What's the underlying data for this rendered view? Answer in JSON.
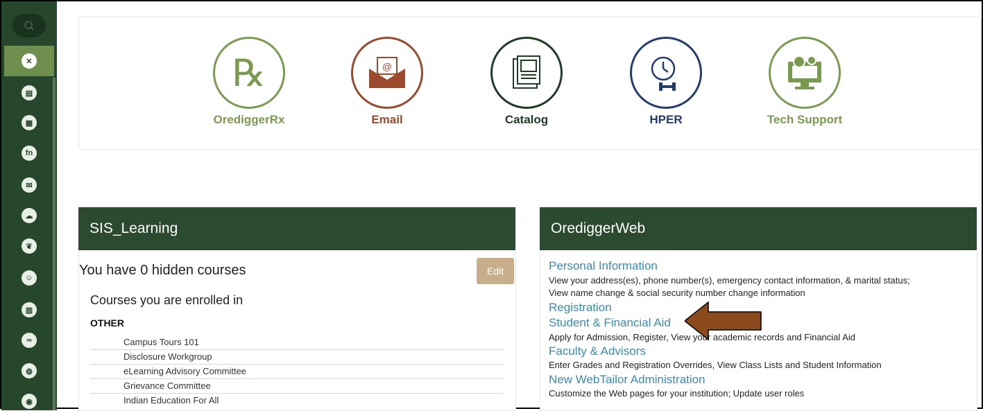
{
  "rail": {
    "icons": [
      "search-icon",
      "tools-icon",
      "document-icon",
      "grid-icon",
      "fn-icon",
      "mail-icon",
      "cloud-icon",
      "leaf-icon",
      "person-icon",
      "building-icon",
      "link-icon",
      "globe-icon",
      "circle-icon"
    ]
  },
  "quick_links": [
    {
      "label": "OrediggerRx",
      "color": "#7a9a4f",
      "icon": "rx-icon"
    },
    {
      "label": "Email",
      "color": "#9b4a2c",
      "icon": "envelope-icon"
    },
    {
      "label": "Catalog",
      "color": "#1f3b24",
      "icon": "catalog-icon"
    },
    {
      "label": "HPER",
      "color": "#233c70",
      "icon": "clock-dumbbell-icon"
    },
    {
      "label": "Tech Support",
      "color": "#7a9a4f",
      "icon": "monitor-gear-icon"
    }
  ],
  "sis": {
    "title": "SIS_Learning",
    "hidden_text": "You have 0 hidden courses",
    "edit_label": "Edit",
    "enrolled_heading": "Courses you are enrolled in",
    "group_label": "OTHER",
    "courses": [
      "Campus Tours 101",
      "Disclosure Workgroup",
      "eLearning Advisory Committee",
      "Grievance Committee",
      "Indian Education For All"
    ]
  },
  "oredigger": {
    "title": "OrediggerWeb",
    "sections": [
      {
        "link": "Personal Information",
        "desc": [
          "View your address(es), phone number(s), emergency contact information, & marital status;",
          "View name change & social security number change information"
        ]
      },
      {
        "link": "Registration",
        "desc": []
      },
      {
        "link": "Student & Financial Aid",
        "desc": [
          "Apply for Admission, Register, View your academic records and Financial Aid"
        ]
      },
      {
        "link": "Faculty & Advisors",
        "desc": [
          "Enter Grades and Registration Overrides, View Class Lists and Student Information"
        ]
      },
      {
        "link": "New WebTailor Administration",
        "desc": [
          "Customize the Web pages for your institution; Update user roles"
        ]
      }
    ]
  },
  "colors": {
    "brand_green": "#2c4a30",
    "link_blue": "#3a8ab3",
    "arrow_brown": "#8b4a1c"
  }
}
